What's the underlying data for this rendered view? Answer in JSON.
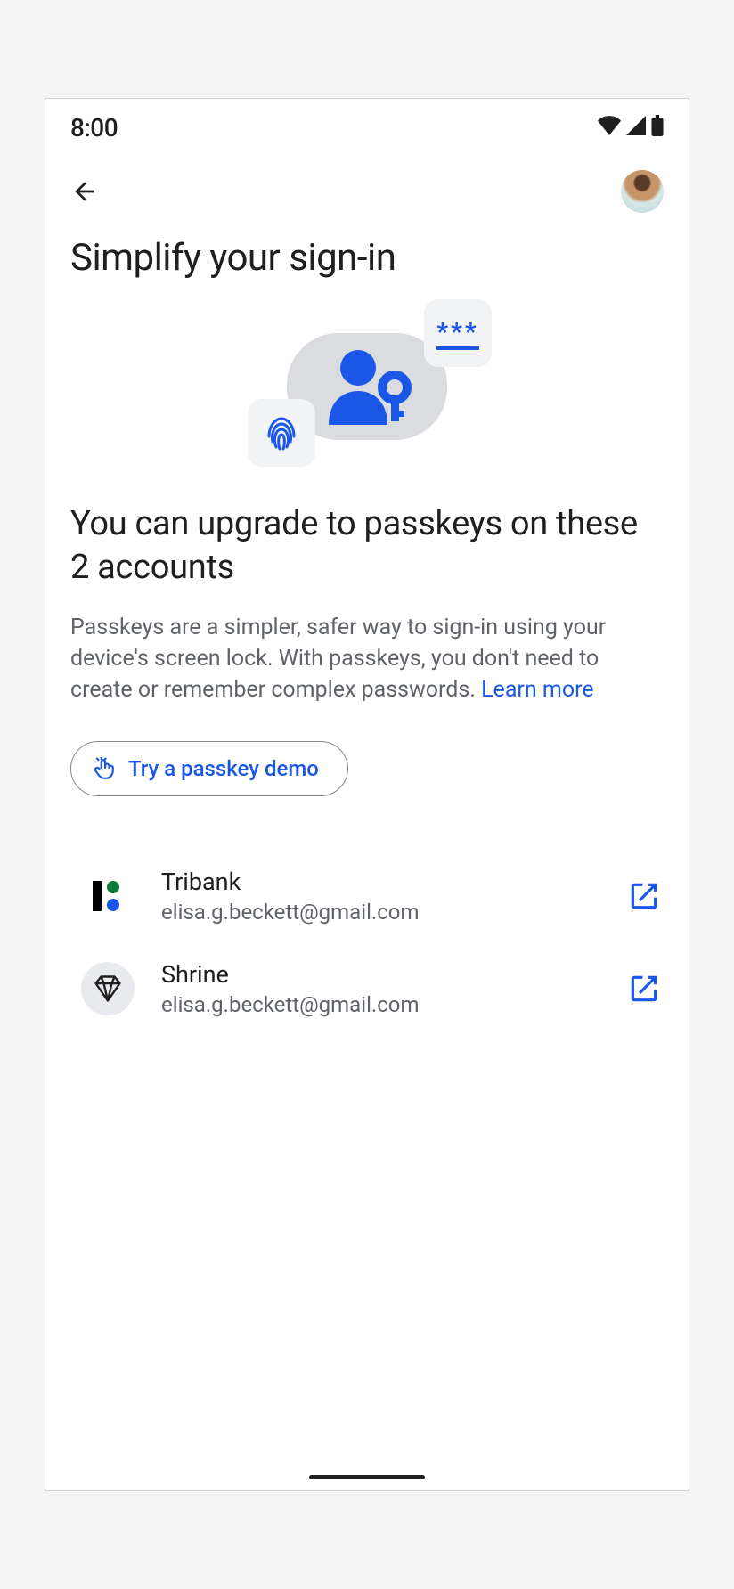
{
  "status": {
    "time": "8:00"
  },
  "page": {
    "title": "Simplify your sign-in"
  },
  "section": {
    "title": "You can upgrade to passkeys on these 2 accounts",
    "description": "Passkeys are a simpler, safer way to sign-in using your device's screen lock. With passkeys, you don't need to create or remember complex passwords. ",
    "learn_more": "Learn more"
  },
  "demo_button": {
    "label": "Try a passkey demo"
  },
  "accounts": [
    {
      "name": "Tribank",
      "email": "elisa.g.beckett@gmail.com",
      "icon": "tribank"
    },
    {
      "name": "Shrine",
      "email": "elisa.g.beckett@gmail.com",
      "icon": "shrine"
    }
  ],
  "colors": {
    "accent": "#1a57e6",
    "text": "#1f1f1f",
    "subtext": "#5f6368"
  }
}
